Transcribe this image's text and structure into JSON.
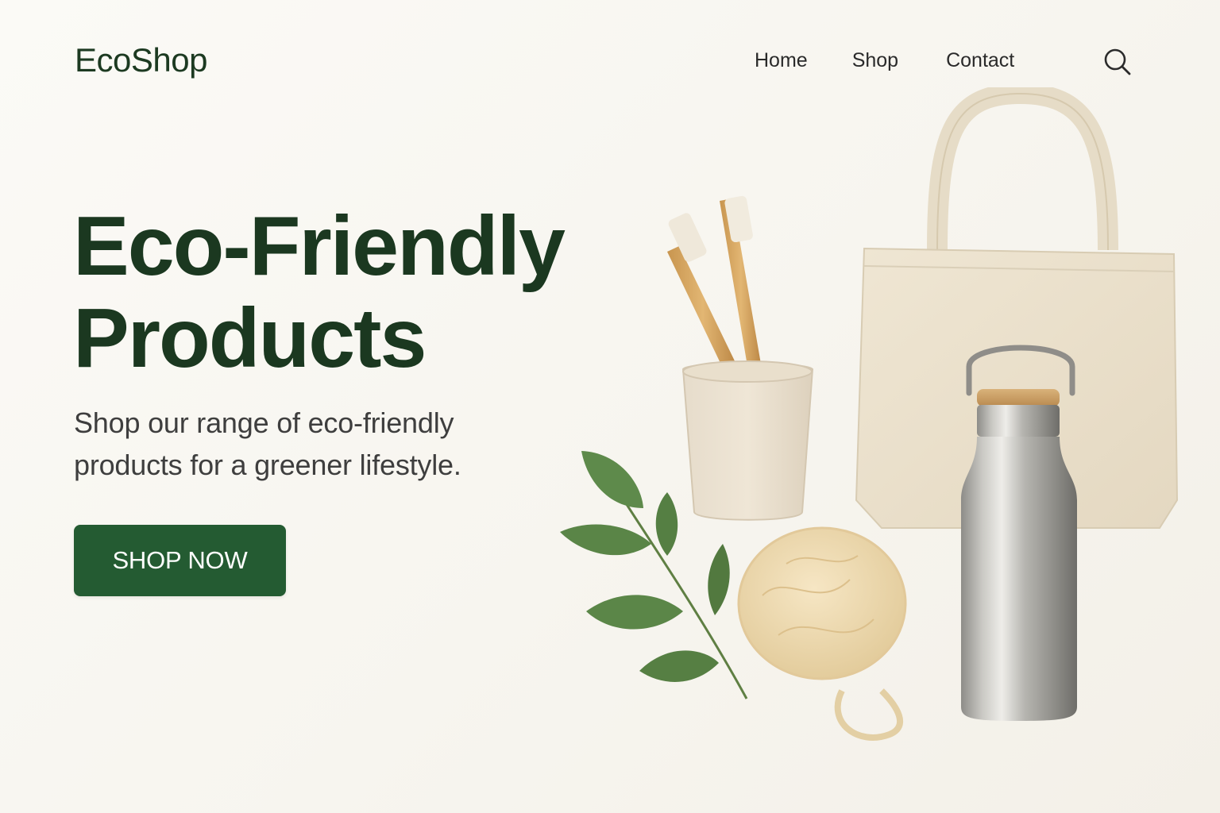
{
  "header": {
    "logo": "EcoShop",
    "nav": [
      {
        "label": "Home"
      },
      {
        "label": "Shop"
      },
      {
        "label": "Contact"
      }
    ],
    "search_icon": "search-icon"
  },
  "hero": {
    "title_line1": "Eco-Friendly",
    "title_line2": "Products",
    "subtitle_line1": "Shop our range of eco-friendly",
    "subtitle_line2": "products for a greener lifestyle.",
    "cta_label": "SHOP NOW"
  },
  "colors": {
    "background": "#f8f6f1",
    "heading": "#1b3820",
    "accent": "#245b32",
    "body_text": "#3e3e3e"
  },
  "illustration": {
    "items": [
      "bamboo-toothbrush",
      "toothbrush-cup",
      "leaf-branch",
      "natural-sponge",
      "canvas-tote-bag",
      "stainless-steel-bottle"
    ]
  }
}
